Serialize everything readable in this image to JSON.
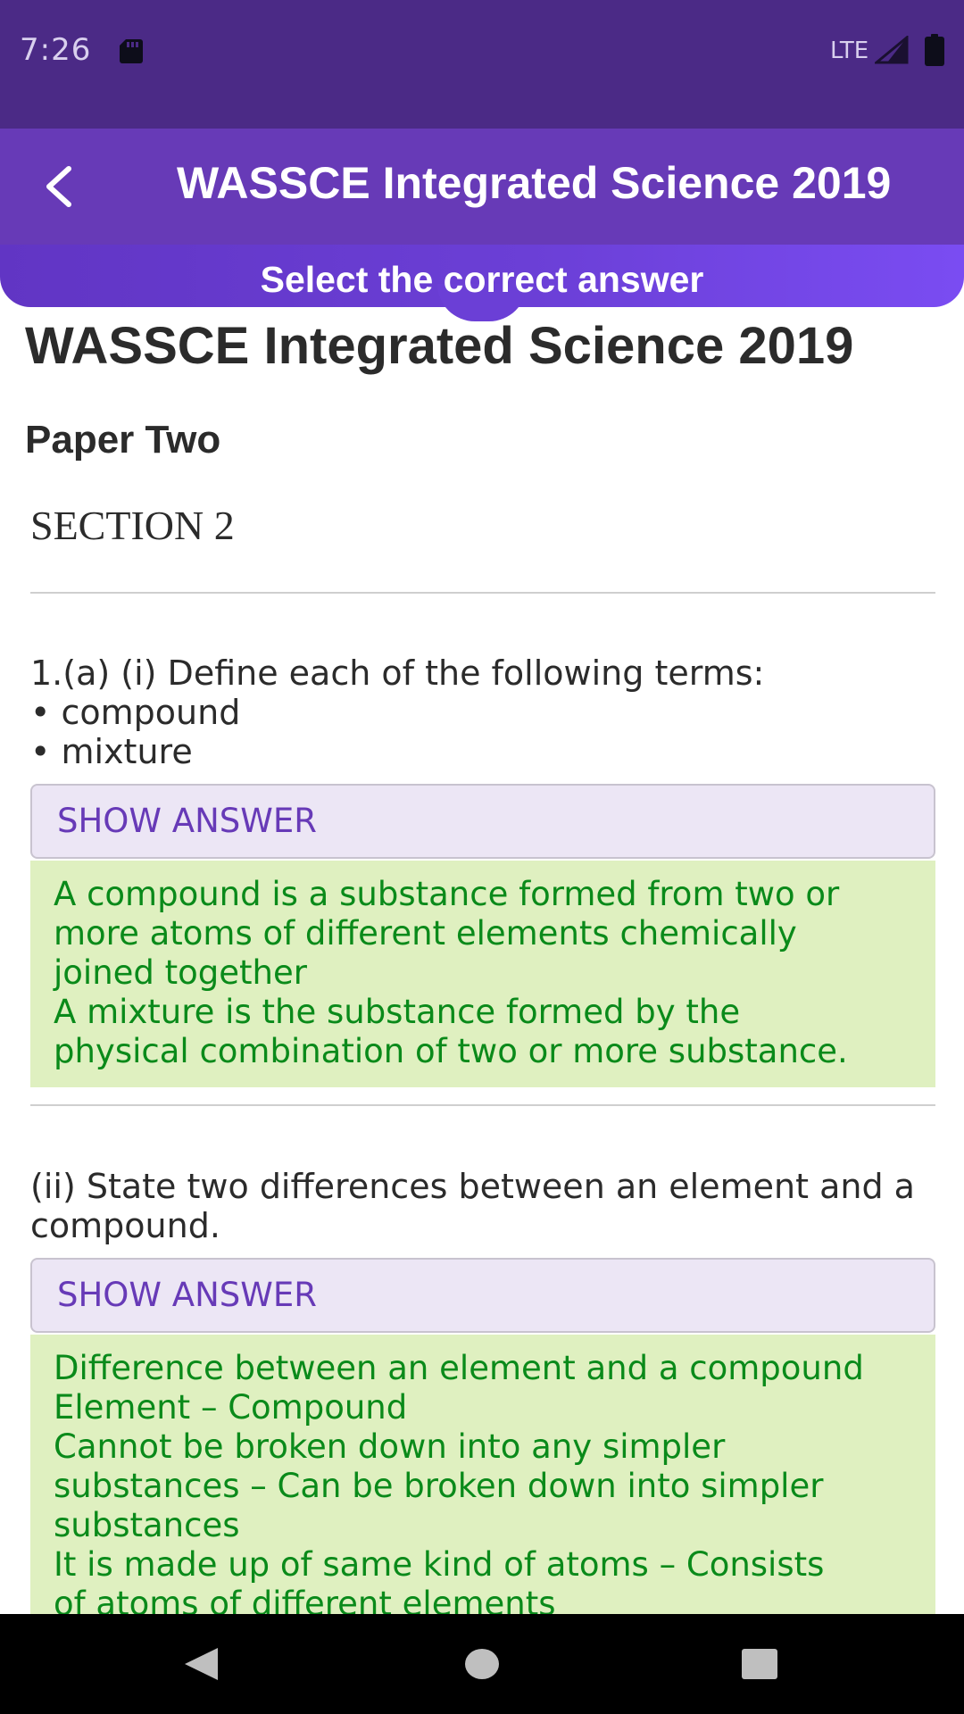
{
  "status_bar": {
    "time": "7:26",
    "network": "LTE",
    "icons": [
      "sd-card-icon",
      "signal-icon",
      "battery-icon"
    ]
  },
  "app_bar": {
    "title": "WASSCE Integrated Science 2019",
    "back_icon": "chevron-left-icon"
  },
  "banner": {
    "text": "Select the correct answer"
  },
  "content": {
    "heading": "WASSCE Integrated Science 2019",
    "paper": "Paper Two",
    "section": "SECTION 2",
    "questions": [
      {
        "lines": [
          "1.(a) (i) Define each of the following terms:",
          "• compound",
          "• mixture"
        ],
        "show_answer_label": "SHOW ANSWER",
        "answer_lines": [
          "A compound is a substance formed from two or",
          "more atoms of different elements chemically",
          "joined together",
          "A mixture is the substance formed by the",
          "physical combination of two or more substance."
        ]
      },
      {
        "lines": [
          "(ii) State two differences between an element and a",
          "compound."
        ],
        "show_answer_label": "SHOW ANSWER",
        "answer_lines": [
          "Difference between an element and a compound",
          "Element – Compound",
          "Cannot be broken down into any simpler",
          "substances – Can be broken down into simpler",
          "substances",
          "It is made up of same kind of atoms – Consists",
          "of atoms of different elements"
        ]
      }
    ]
  },
  "colors": {
    "status_bar": "#4b2a86",
    "app_bar": "#673ab7",
    "accent": "#673ab7",
    "answer_bg": "#dff0c0",
    "answer_text": "#0a8a1a",
    "show_answer_bg": "#ece6f5"
  },
  "nav_bar": {
    "icons": [
      "back-triangle-icon",
      "home-circle-icon",
      "recents-square-icon"
    ]
  }
}
